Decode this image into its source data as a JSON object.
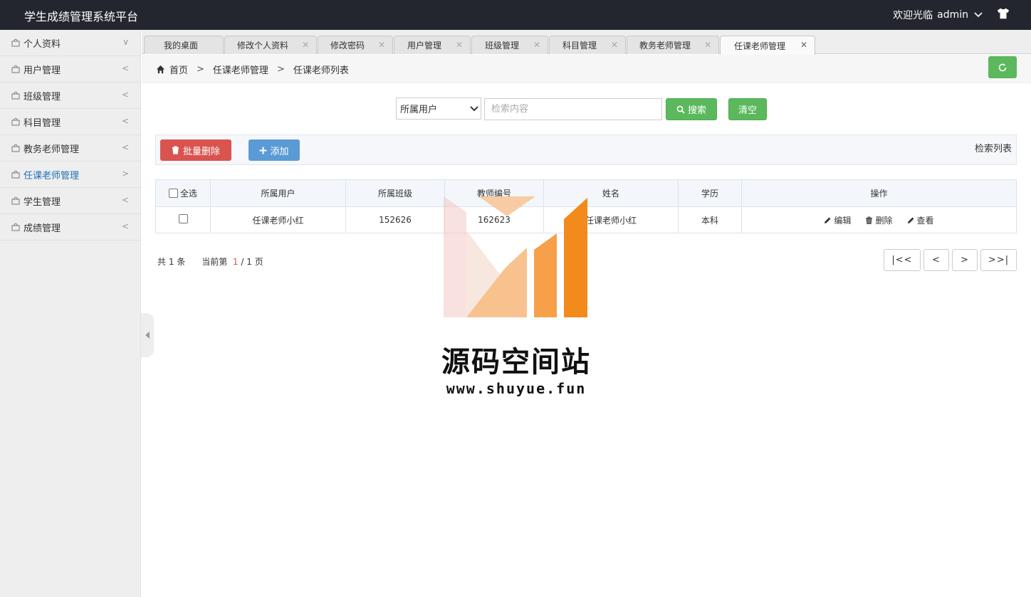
{
  "header": {
    "app_title": "学生成绩管理系统平台",
    "welcome_text": "欢迎光临",
    "username": "admin"
  },
  "sidebar": {
    "items": [
      {
        "label": "个人资料",
        "arrow": "∨"
      },
      {
        "label": "用户管理",
        "arrow": "<"
      },
      {
        "label": "班级管理",
        "arrow": "<"
      },
      {
        "label": "科目管理",
        "arrow": "<"
      },
      {
        "label": "教务老师管理",
        "arrow": "<"
      },
      {
        "label": "任课老师管理",
        "arrow": ">"
      },
      {
        "label": "学生管理",
        "arrow": "<"
      },
      {
        "label": "成绩管理",
        "arrow": "<"
      }
    ],
    "active_index": 5
  },
  "tabs": [
    {
      "label": "我的桌面",
      "closable": false
    },
    {
      "label": "修改个人资料",
      "closable": true
    },
    {
      "label": "修改密码",
      "closable": true
    },
    {
      "label": "用户管理",
      "closable": true
    },
    {
      "label": "班级管理",
      "closable": true
    },
    {
      "label": "科目管理",
      "closable": true
    },
    {
      "label": "教务老师管理",
      "closable": true
    },
    {
      "label": "任课老师管理",
      "closable": true,
      "active": true
    }
  ],
  "breadcrumb": {
    "home": "首页",
    "level1": "任课老师管理",
    "level2": "任课老师列表",
    "separator": ">"
  },
  "search": {
    "field_selected": "所属用户",
    "placeholder": "检索内容",
    "value": "",
    "search_label": "搜索",
    "clear_label": "清空"
  },
  "toolbar": {
    "batch_delete_label": "批量删除",
    "add_label": "添加",
    "list_title": "检索列表"
  },
  "table": {
    "select_all_label": "全选",
    "columns": [
      "所属用户",
      "所属班级",
      "教师编号",
      "姓名",
      "学历",
      "操作"
    ],
    "rows": [
      {
        "user": "任课老师小红",
        "class": "152626",
        "teacher_no": "162623",
        "name": "任课老师小红",
        "education": "本科"
      }
    ],
    "actions": {
      "edit": "编辑",
      "delete": "删除",
      "view": "查看"
    }
  },
  "pagination": {
    "total_prefix": "共",
    "total": "1",
    "total_suffix": "条",
    "current_prefix": "当前第",
    "current_page": "1",
    "page_sep": "/",
    "total_pages": "1",
    "page_suffix": "页",
    "first": "|<<",
    "prev": "<",
    "next": ">",
    "last": ">>|"
  },
  "watermark": {
    "name": "源码空间站",
    "url": "www.shuyue.fun"
  },
  "colors": {
    "header_bg": "#23262e",
    "success": "#5cb85c",
    "danger": "#d9534f",
    "primary": "#5b9bd5",
    "active_link": "#1e6fb8"
  }
}
